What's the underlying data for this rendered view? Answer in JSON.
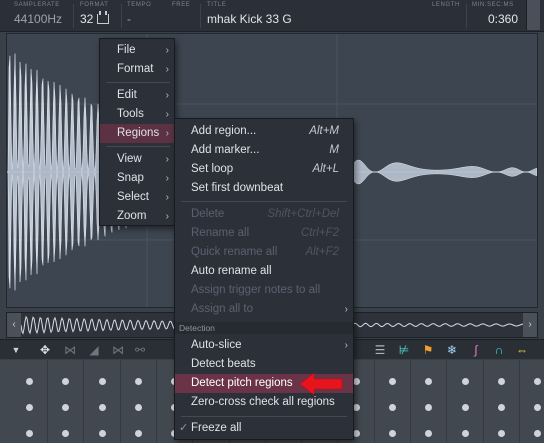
{
  "info_bar": {
    "samplerate_label": "SAMPLERATE",
    "samplerate_value": "44100Hz",
    "format_label": "FORMAT",
    "format_value": "32",
    "format_icon": "format-icon",
    "tempo_label": "TEMPO",
    "tempo_value": "-",
    "free_label": "FREE",
    "title_label": "TITLE",
    "title_value": "mhak Kick 33 G",
    "length_label": "LENGTH",
    "minsecms_label": "MIN:SEC:MS",
    "length_value": "0:360"
  },
  "main_menu": {
    "items": [
      {
        "label": "File",
        "has_submenu": true
      },
      {
        "label": "Format",
        "has_submenu": true
      },
      {
        "label": "Edit",
        "has_submenu": true
      },
      {
        "label": "Tools",
        "has_submenu": true
      },
      {
        "label": "Regions",
        "has_submenu": true,
        "active": true
      },
      {
        "label": "View",
        "has_submenu": true
      },
      {
        "label": "Snap",
        "has_submenu": true
      },
      {
        "label": "Select",
        "has_submenu": true
      },
      {
        "label": "Zoom",
        "has_submenu": true
      }
    ]
  },
  "regions_menu": {
    "items": [
      {
        "label": "Add region...",
        "hotkey": "Alt+M",
        "enabled": true
      },
      {
        "label": "Add marker...",
        "hotkey": "M",
        "enabled": true
      },
      {
        "label": "Set loop",
        "hotkey": "Alt+L",
        "enabled": true
      },
      {
        "label": "Set first downbeat",
        "hotkey": "",
        "enabled": true
      },
      {
        "label": "Delete",
        "hotkey": "Shift+Ctrl+Del",
        "enabled": false
      },
      {
        "label": "Rename all",
        "hotkey": "Ctrl+F2",
        "enabled": false
      },
      {
        "label": "Quick rename all",
        "hotkey": "Alt+F2",
        "enabled": false
      },
      {
        "label": "Auto rename all",
        "hotkey": "",
        "enabled": true
      },
      {
        "label": "Assign trigger notes to all",
        "hotkey": "",
        "enabled": false
      },
      {
        "label": "Assign all to",
        "hotkey": "",
        "enabled": false,
        "has_submenu": true
      }
    ],
    "detection_header": "Detection",
    "detection_items": [
      {
        "label": "Auto-slice",
        "has_submenu": true
      },
      {
        "label": "Detect beats"
      },
      {
        "label": "Detect pitch regions",
        "highlighted": true
      },
      {
        "label": "Zero-cross check all regions"
      }
    ],
    "freeze": {
      "label": "Freeze all",
      "checked": true
    }
  },
  "toolbar": {
    "icons": [
      "chevron-down-icon",
      "snap-point-icon",
      "crop-icon",
      "triangle-icon",
      "split-icon",
      "link-icon",
      "slice-icon",
      "regions-icon",
      "pitch-detect-icon",
      "flag-icon",
      "freeze-icon",
      "curve-icon",
      "magnet-icon",
      "stretch-icon"
    ]
  },
  "colors": {
    "highlight": "#6a3347",
    "arrow": "#e8141c",
    "waveform": "#cdd6e3",
    "panel_bg": "#3d4550",
    "menu_bg": "#2c3139"
  }
}
